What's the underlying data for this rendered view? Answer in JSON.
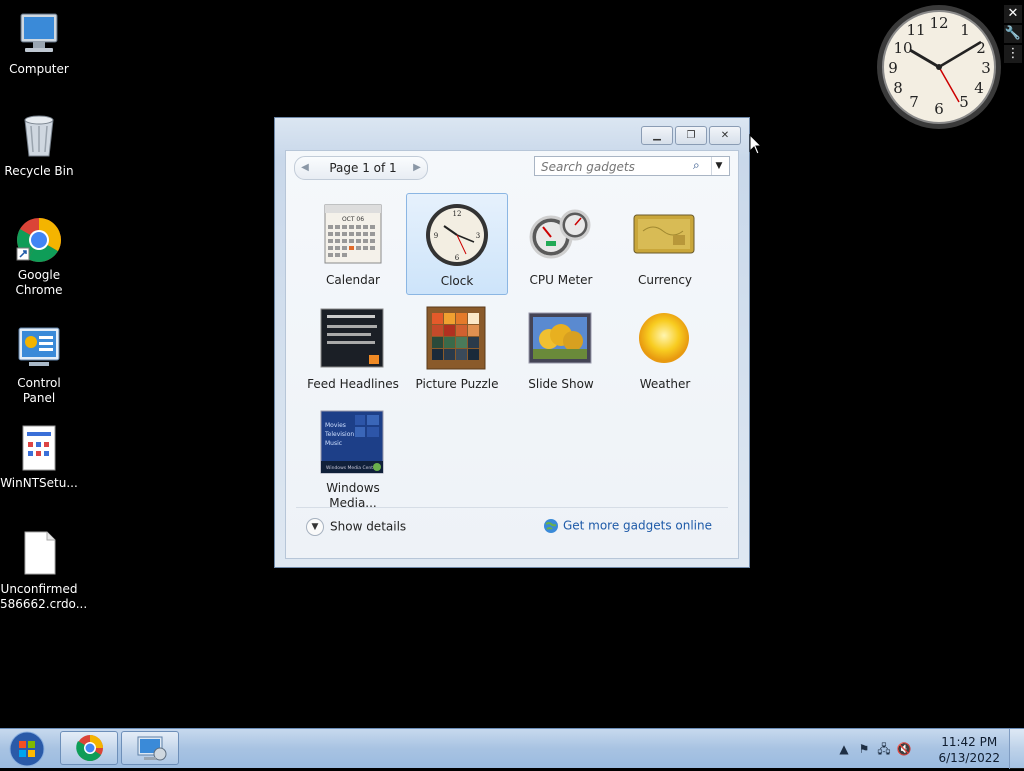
{
  "desktop": {
    "icons": [
      {
        "label": "Computer"
      },
      {
        "label": "Recycle Bin"
      },
      {
        "label": "Google Chrome"
      },
      {
        "label": "Control Panel"
      },
      {
        "label": "WinNTSetu..."
      },
      {
        "label": "Unconfirmed 586662.crdo..."
      }
    ]
  },
  "gallery": {
    "pager_text": "Page 1 of 1",
    "search_placeholder": "Search gadgets",
    "gadgets": [
      {
        "label": "Calendar",
        "icon": "calendar-icon"
      },
      {
        "label": "Clock",
        "icon": "clock-icon",
        "selected": true
      },
      {
        "label": "CPU Meter",
        "icon": "cpu-meter-icon"
      },
      {
        "label": "Currency",
        "icon": "currency-icon"
      },
      {
        "label": "Feed Headlines",
        "icon": "feed-headlines-icon"
      },
      {
        "label": "Picture Puzzle",
        "icon": "picture-puzzle-icon"
      },
      {
        "label": "Slide Show",
        "icon": "slide-show-icon"
      },
      {
        "label": "Weather",
        "icon": "weather-icon"
      },
      {
        "label": "Windows Media...",
        "icon": "windows-media-center-icon"
      }
    ],
    "calendar_month": "OCT 06",
    "media_lines": [
      "Movies",
      "Television",
      "Music",
      "Windows Media Center"
    ],
    "show_details": "Show details",
    "more_link": "Get more gadgets online"
  },
  "taskbar": {
    "time": "11:42 PM",
    "date": "6/13/2022"
  },
  "colors": {
    "accent": "#1e5aa8",
    "selection": "#cde4fa",
    "taskbar": "#a8c3e2"
  }
}
